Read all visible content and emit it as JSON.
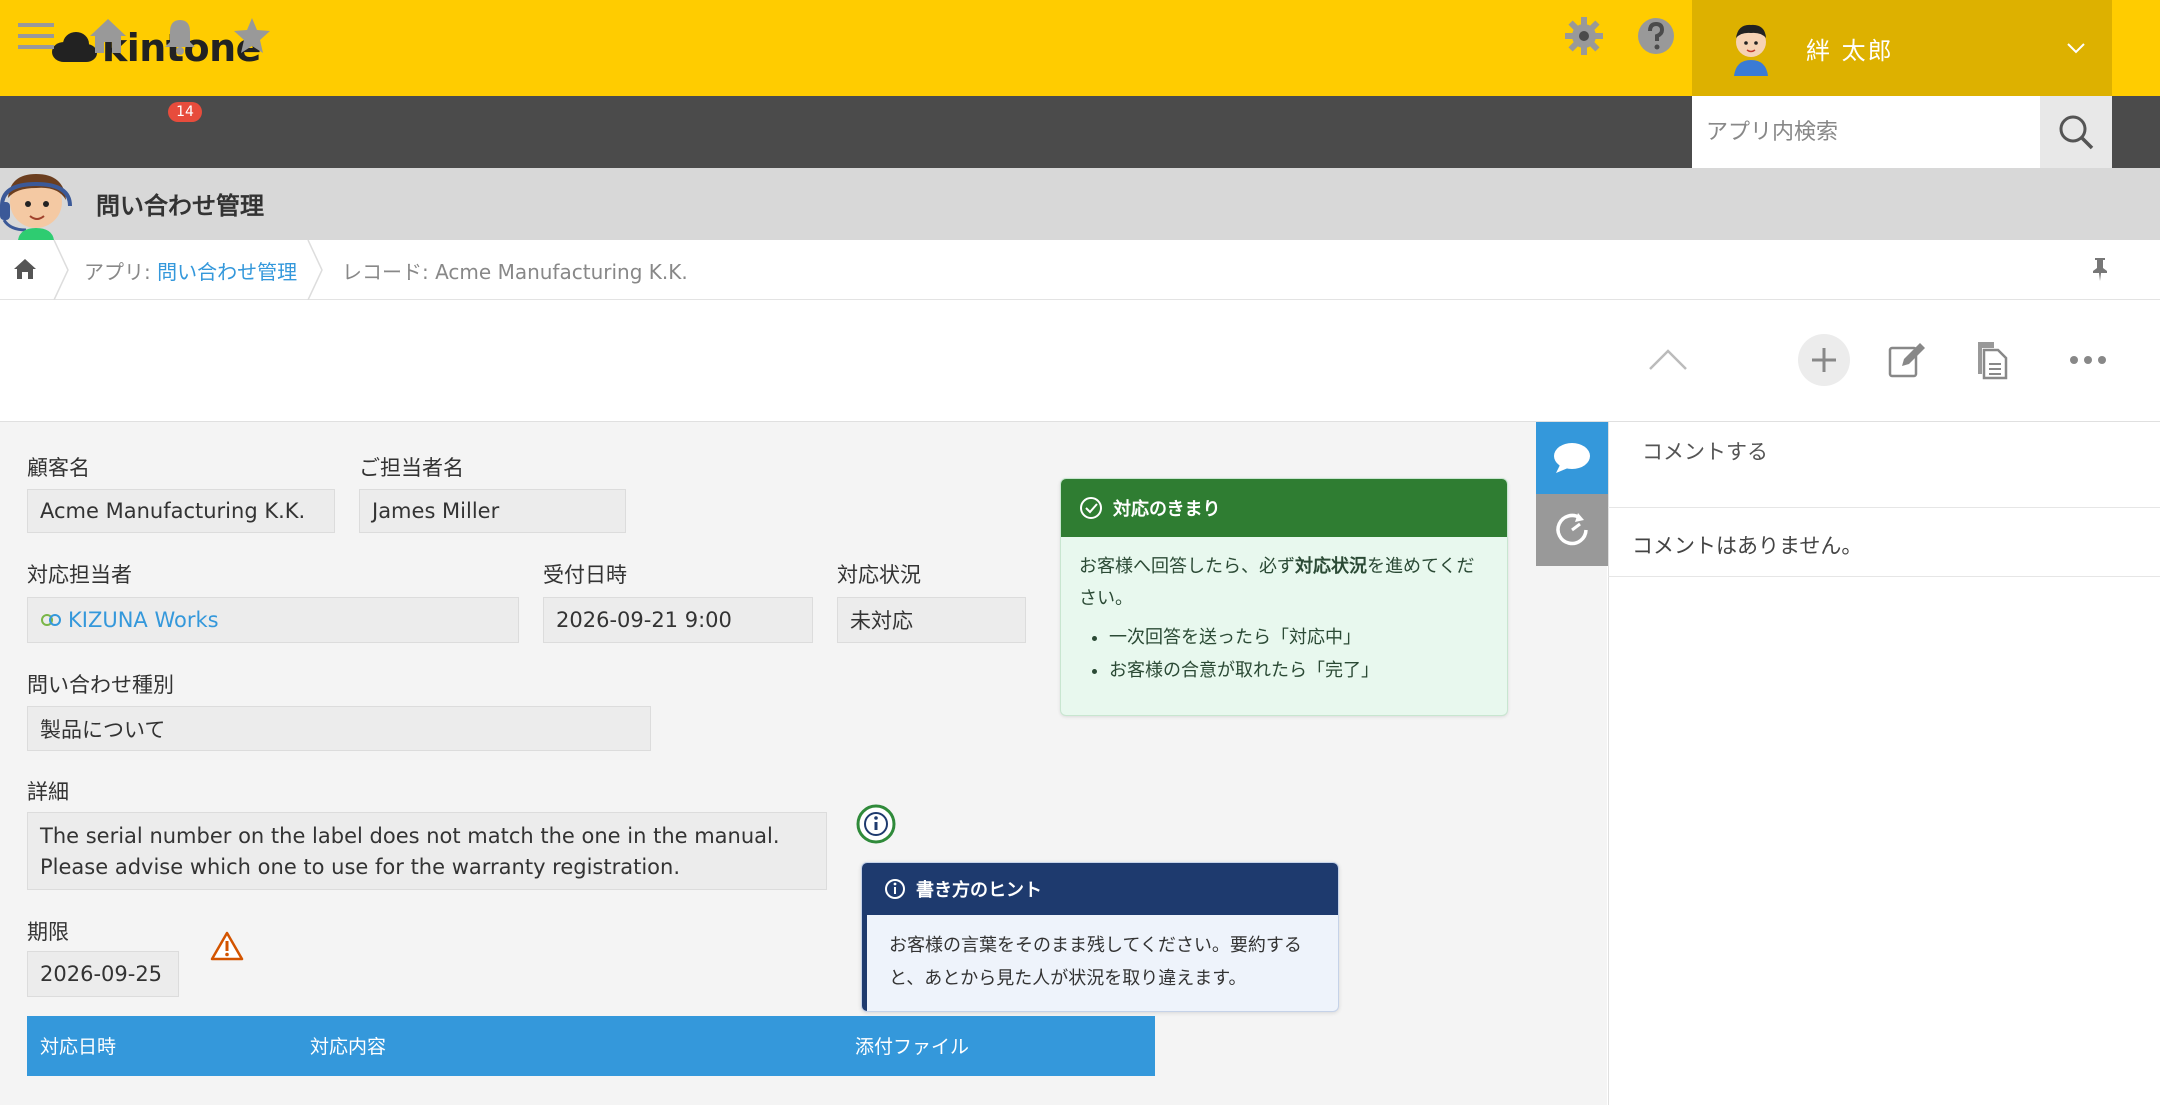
{
  "header": {
    "logo_text": "kintone",
    "user_name": "絆 太郎"
  },
  "nav": {
    "notification_count": "14",
    "search_placeholder": "アプリ内検索"
  },
  "app": {
    "title": "問い合わせ管理"
  },
  "breadcrumb": {
    "app_prefix": "アプリ: ",
    "app_link": "問い合わせ管理",
    "record_label": "レコード: Acme Manufacturing K.K."
  },
  "record": {
    "customer_label": "顧客名",
    "customer_value": "Acme Manufacturing K.K.",
    "contact_label": "ご担当者名",
    "contact_value": "James Miller",
    "assignee_label": "対応担当者",
    "assignee_value": "KIZUNA Works",
    "received_label": "受付日時",
    "received_value": "2026-09-21 9:00",
    "status_label": "対応状況",
    "status_value": "未対応",
    "type_label": "問い合わせ種別",
    "type_value": "製品について",
    "detail_label": "詳細",
    "detail_value_1": "The serial number on the label does not match the one in the manual.",
    "detail_value_2": "Please advise which one to use for the warranty registration.",
    "deadline_label": "期限",
    "deadline_value": "2026-09-25"
  },
  "rule_panel": {
    "title": "対応のきまり",
    "text_before": "お客様へ回答したら、必ず",
    "text_bold": "対応状況",
    "text_after": "を進めてください。",
    "bullets": [
      "一次回答を送ったら「対応中」",
      "お客様の合意が取れたら「完了」"
    ]
  },
  "hint_panel": {
    "title": "書き方のヒント",
    "text": "お客様の言葉をそのまま残してください。要約すると、あとから見た人が状況を取り違えます。"
  },
  "table": {
    "columns": [
      "対応日時",
      "対応内容",
      "添付ファイル"
    ]
  },
  "side": {
    "comment_placeholder": "コメントする",
    "no_comments": "コメントはありません。"
  },
  "colors": {
    "header_yellow": "#ffcc00",
    "user_menu": "#ddb100",
    "nav_dark": "#4b4b4b",
    "link_blue": "#3498db",
    "rule_green": "#2f7d32",
    "hint_navy": "#1e3a6e"
  },
  "icons": [
    "menu-icon",
    "home-icon",
    "bell-icon",
    "star-icon",
    "gear-icon",
    "help-icon",
    "search-icon",
    "pin-icon",
    "chevron-up-icon",
    "plus-icon",
    "edit-icon",
    "copy-icon",
    "more-icon",
    "comment-icon",
    "history-icon",
    "info-icon",
    "warning-icon",
    "check-circle-icon"
  ]
}
